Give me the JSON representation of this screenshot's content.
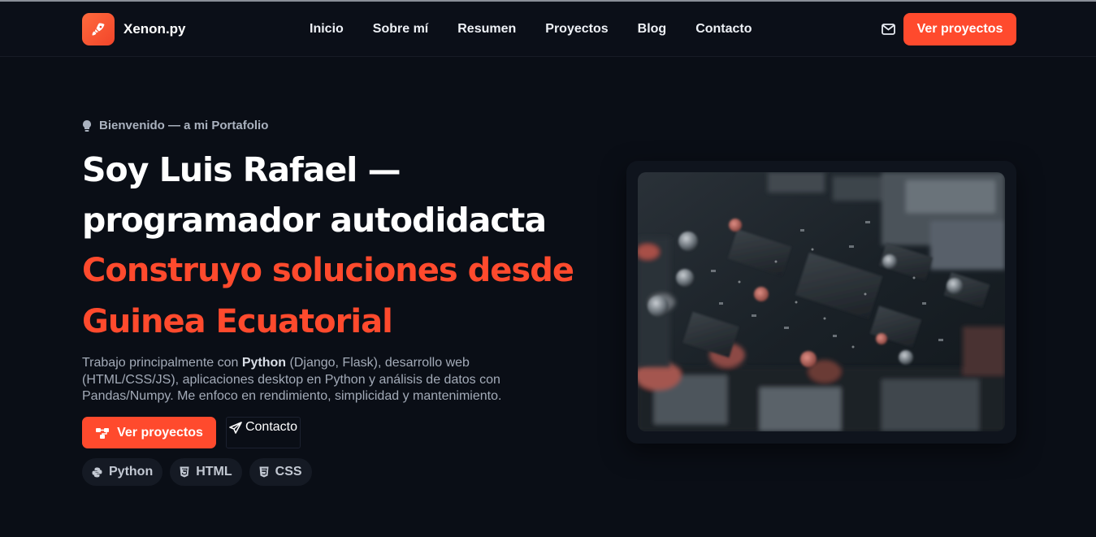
{
  "brand": {
    "name": "Xenon.py",
    "logo_icon": "rocket-icon",
    "accent": "#ff4a2d"
  },
  "nav": {
    "links": [
      "Inicio",
      "Sobre mí",
      "Resumen",
      "Proyectos",
      "Blog",
      "Contacto"
    ],
    "mail_icon": "mail-icon",
    "cta_label": "Ver proyectos"
  },
  "hero": {
    "eyebrow": "Bienvenido — a mi Portafolio",
    "eyebrow_icon": "lightbulb-icon",
    "title_line1": "Soy Luis Rafael —",
    "title_line2": "programador autodidacta",
    "accent_line1": "Construyo soluciones desde",
    "accent_line2": "Guinea Ecuatorial",
    "desc_part1": "Trabajo principalmente con ",
    "desc_bold": "Python",
    "desc_part2": " (Django, Flask), desarrollo web (HTML/CSS/JS), aplicaciones desktop en Python y análisis de datos con Pandas/Numpy. Me enfoco en rendimiento, simplicidad y mantenimiento.",
    "primary_button": "Ver proyectos",
    "secondary_button": "Contacto",
    "chips": [
      {
        "label": "Python",
        "icon": "python-icon"
      },
      {
        "label": "HTML",
        "icon": "html5-icon"
      },
      {
        "label": "CSS",
        "icon": "css3-icon"
      }
    ]
  },
  "image": {
    "subject": "circuit-board-photo"
  }
}
